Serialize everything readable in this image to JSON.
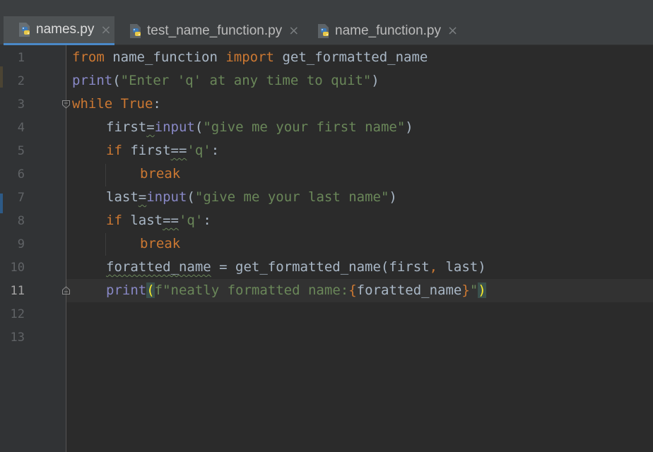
{
  "tabs": [
    {
      "label": "names.py",
      "active": true
    },
    {
      "label": "test_name_function.py",
      "active": false
    },
    {
      "label": "name_function.py",
      "active": false
    }
  ],
  "close_glyph": "×",
  "current_line": 11,
  "lines": [
    {
      "n": "1"
    },
    {
      "n": "2"
    },
    {
      "n": "3"
    },
    {
      "n": "4"
    },
    {
      "n": "5"
    },
    {
      "n": "6"
    },
    {
      "n": "7"
    },
    {
      "n": "8"
    },
    {
      "n": "9"
    },
    {
      "n": "10"
    },
    {
      "n": "11"
    },
    {
      "n": "12"
    },
    {
      "n": "13"
    }
  ],
  "code": {
    "l1": {
      "kw1": "from",
      "mod": " name_function ",
      "kw2": "import",
      "name": " get_formatted_name"
    },
    "l2": {
      "fn": "print",
      "open": "(",
      "str": "\"Enter 'q' at any time to quit\"",
      "close": ")"
    },
    "l3": {
      "kw": "while",
      "sp": " ",
      "val": "True",
      "colon": ":"
    },
    "l4": {
      "var": "first",
      "eq": "=",
      "fn": "input",
      "open": "(",
      "str": "\"give me your first name\"",
      "close": ")"
    },
    "l5": {
      "kw": "if",
      "var": " first",
      "op": "==",
      "str": "'q'",
      "colon": ":"
    },
    "l6": {
      "kw": "break"
    },
    "l7": {
      "var": "last",
      "eq": "=",
      "fn": "input",
      "open": "(",
      "str": "\"give me your last name\"",
      "close": ")"
    },
    "l8": {
      "kw": "if",
      "var": " last",
      "op": "==",
      "str": "'q'",
      "colon": ":"
    },
    "l9": {
      "kw": "break"
    },
    "l10": {
      "var": "foratted_name",
      "rest": " = get_formatted_name(first",
      "comma": ",",
      "rest2": " last)"
    },
    "l11": {
      "fn": "print",
      "open": "(",
      "fstr1": "f\"neatly formatted name:",
      "lb": "{",
      "expr": "foratted_name",
      "rb": "}",
      "fstr2": "\"",
      "close": ")"
    }
  },
  "colors": {
    "keyword": "#cc7832",
    "builtin": "#8888c6",
    "string": "#6a8759",
    "text": "#a9b7c6",
    "background": "#2b2b2b",
    "gutter": "#313335",
    "accent": "#4a88c7"
  }
}
